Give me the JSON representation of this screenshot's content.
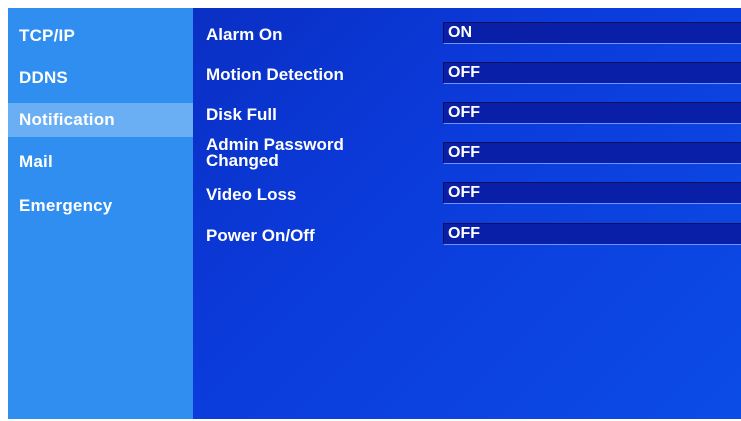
{
  "sidebar": {
    "items": [
      {
        "label": "TCP/IP"
      },
      {
        "label": "DDNS"
      },
      {
        "label": "Notification"
      },
      {
        "label": "Mail"
      },
      {
        "label": "Emergency"
      }
    ],
    "selected": "Notification"
  },
  "notification": {
    "rows": [
      {
        "label": "Alarm On",
        "value": "ON"
      },
      {
        "label": "Motion Detection",
        "value": "OFF"
      },
      {
        "label": "Disk Full",
        "value": "OFF"
      },
      {
        "label": "Admin Password Changed",
        "label_line1": "Admin Password",
        "label_line2": "Changed",
        "value": "OFF"
      },
      {
        "label": "Video Loss",
        "value": "OFF"
      },
      {
        "label": "Power On/Off",
        "value": "OFF"
      }
    ]
  },
  "colors": {
    "sidebar_bg": "#2f8ef0",
    "sidebar_active": "#6aaef3",
    "main_bg": "#0b3bdb",
    "field_bg": "#0a1fa8",
    "text": "#ffffff"
  }
}
